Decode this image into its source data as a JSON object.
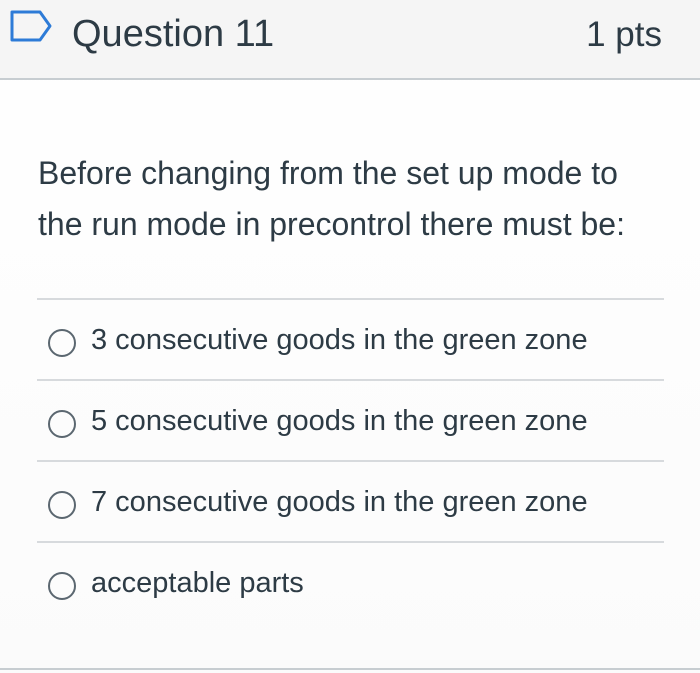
{
  "question": {
    "title": "Question 11",
    "points": "1 pts",
    "prompt": "Before changing from the set up mode to the run mode in precontrol there must be:",
    "flag_icon": "flag-outline-icon"
  },
  "answers": [
    {
      "label": "3 consecutive goods in the green zone",
      "selected": false
    },
    {
      "label": "5 consecutive goods in the green zone",
      "selected": false
    },
    {
      "label": "7 consecutive goods in the green zone",
      "selected": false
    },
    {
      "label": "acceptable parts",
      "selected": false
    }
  ],
  "colors": {
    "text": "#2d3b45",
    "header_background": "#f5f5f5",
    "divider": "#d7dadd",
    "radio_border": "#5b6770"
  }
}
